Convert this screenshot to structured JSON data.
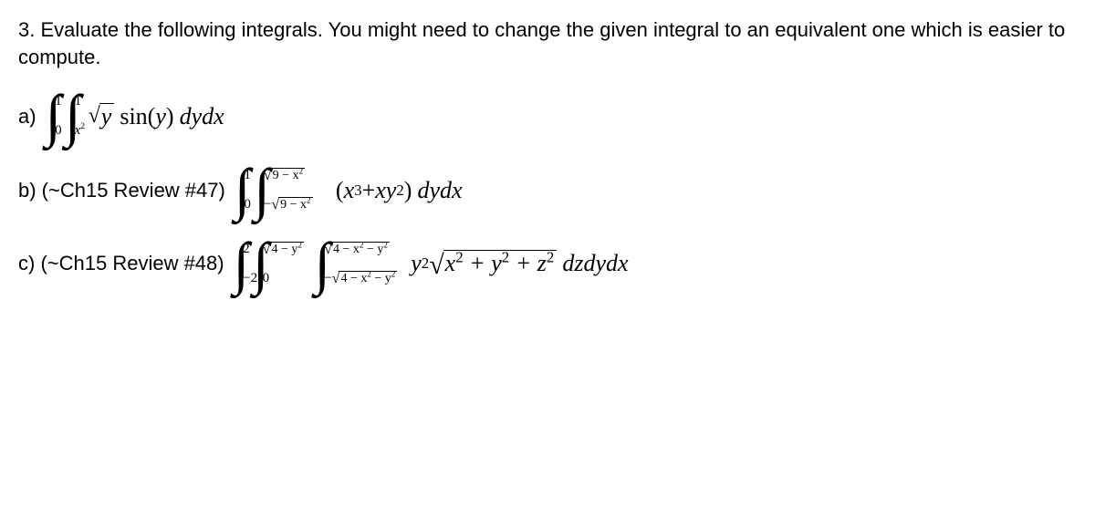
{
  "problem": {
    "number": "3.",
    "text": "Evaluate the following integrals.  You might need to change the given integral to an equivalent one which is easier to compute."
  },
  "parts": {
    "a": {
      "label": "a)",
      "outer_lb": "0",
      "outer_ub": "1",
      "inner_ub": "1",
      "integrand_left": "sin(",
      "integrand_var": "y",
      "integrand_right": ")",
      "diff": "dydx",
      "sqrt_arg": "y",
      "inner_lb_var": "x",
      "inner_lb_exp": "2"
    },
    "b": {
      "label": "b) (~Ch15 Review #47)",
      "outer_lb": "0",
      "outer_ub": "1",
      "bound_rad": "9 − x",
      "bound_exp": "2",
      "neg": "−",
      "integrand_open": "(",
      "term1_var": "x",
      "term1_exp": "3",
      "plus": " + ",
      "term2a": "xy",
      "term2_exp": "2",
      "integrand_close": ")",
      "diff": "dydx"
    },
    "c": {
      "label": "c) (~Ch15 Review #48)",
      "outer_lb": "−2",
      "outer_ub": "2",
      "mid_lb": "0",
      "mid_rad": "4 − y",
      "mid_exp": "2",
      "inner_rad_a": "4 − x",
      "inner_exp_a": "2",
      "inner_rad_b": " − y",
      "inner_exp_b": "2",
      "neg": "−",
      "coef_var": "y",
      "coef_exp": "2",
      "sqrt_t1": "x",
      "sqrt_e1": "2",
      "sqrt_p1": " + y",
      "sqrt_e2": "2",
      "sqrt_p2": " + z",
      "sqrt_e3": "2",
      "diff": "dzdydx"
    }
  }
}
